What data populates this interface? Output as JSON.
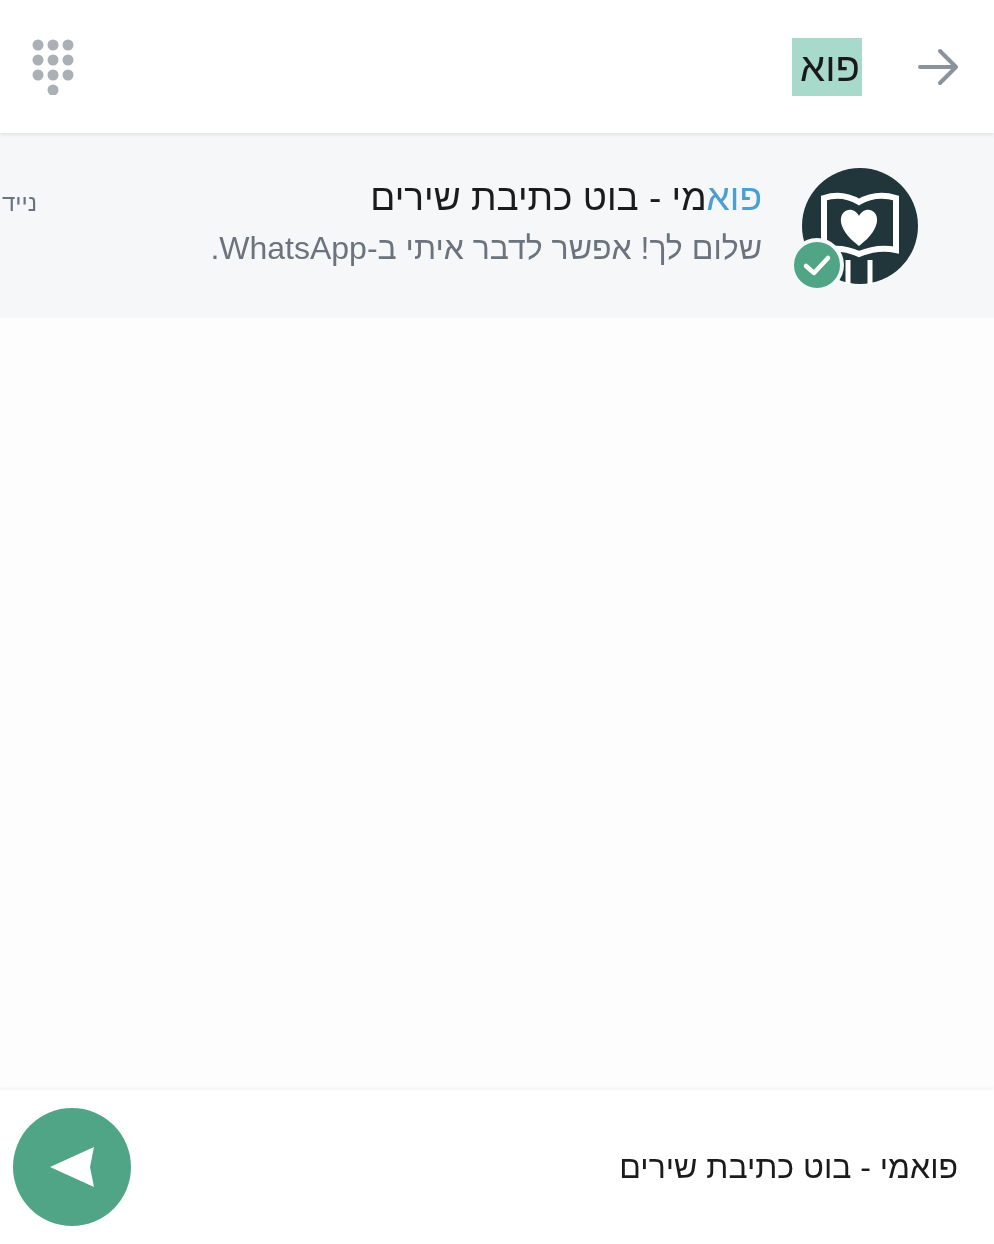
{
  "search_bar": {
    "query": "פוא",
    "query_highlighted": true
  },
  "results": [
    {
      "name_match": "פוא",
      "name_rest": "מי - בוט כתיבת שירים",
      "message": "שלום לך! אפשר לדבר איתי ב-WhatsApp.",
      "label": "נייד",
      "verified": true
    }
  ],
  "footer": {
    "text": "פואמי - בוט כתיבת שירים"
  }
}
